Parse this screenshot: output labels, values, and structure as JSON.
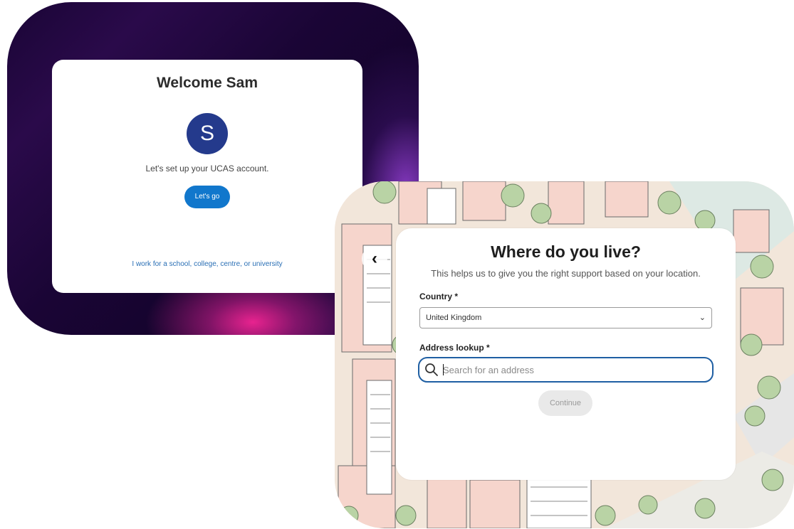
{
  "welcome": {
    "title": "Welcome Sam",
    "avatar_initial": "S",
    "message": "Let's set up your UCAS account.",
    "go_label": "Let's go",
    "school_link": "I work for a school, college, centre, or university"
  },
  "address": {
    "back_icon": "chevron-left-icon",
    "title": "Where do you live?",
    "subtitle": "This helps us to give you the right support based on your location.",
    "country_label": "Country *",
    "country_value": "United Kingdom",
    "lookup_label": "Address lookup *",
    "search_placeholder": "Search for an address",
    "continue_label": "Continue"
  },
  "colors": {
    "brand_blue": "#1177cc",
    "avatar_blue": "#243a8c",
    "focus_border": "#1f5fa3",
    "welcome_bg": "#1a0536",
    "accent_pink": "#e8238f"
  }
}
